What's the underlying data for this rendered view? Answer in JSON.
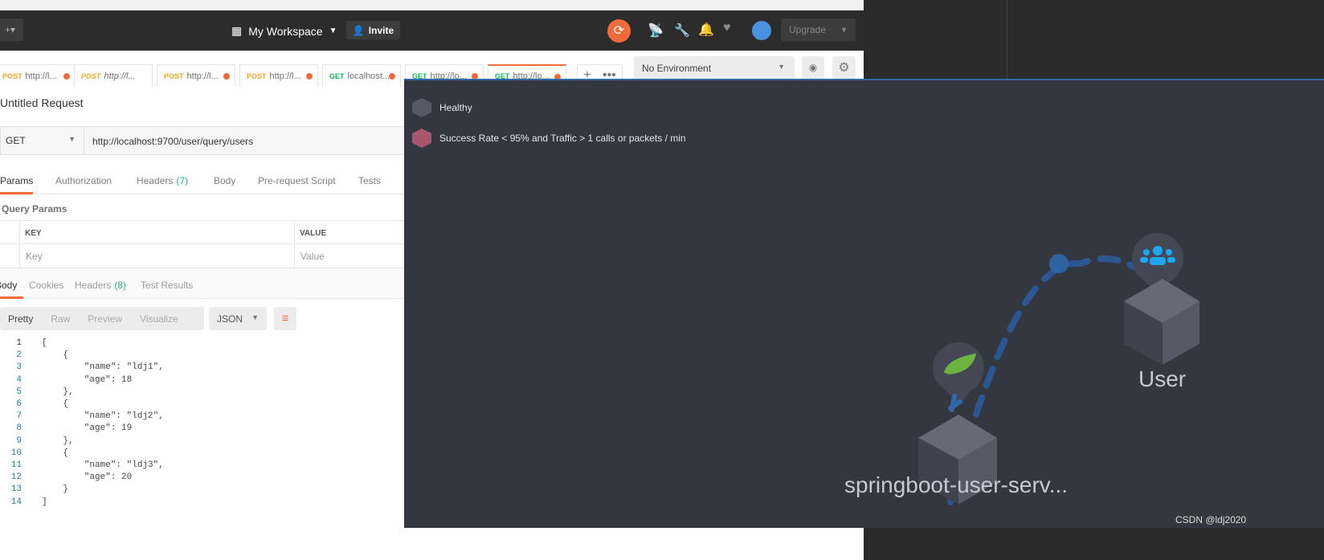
{
  "header": {
    "workspace": "My Workspace",
    "invite": "Invite",
    "upgrade": "Upgrade"
  },
  "tabs": [
    {
      "method": "POST",
      "url": "http://l...",
      "dirty": true,
      "italic": false
    },
    {
      "method": "POST",
      "url": "http://l...",
      "dirty": false,
      "italic": true
    },
    {
      "method": "POST",
      "url": "http://l...",
      "dirty": true,
      "italic": false
    },
    {
      "method": "POST",
      "url": "http://l...",
      "dirty": true,
      "italic": false
    },
    {
      "method": "GET",
      "url": "localhost...",
      "dirty": true,
      "italic": false
    },
    {
      "method": "GET",
      "url": "http://lo...",
      "dirty": true,
      "italic": false
    },
    {
      "method": "GET",
      "url": "http://lo...",
      "dirty": true,
      "italic": false,
      "active": true
    }
  ],
  "environment": "No Environment",
  "request": {
    "title": "Untitled Request",
    "method": "GET",
    "url": "http://localhost:9700/user/query/users"
  },
  "req_tabs": [
    "Params",
    "Authorization",
    "Headers",
    "Body",
    "Pre-request Script",
    "Tests"
  ],
  "req_headers_count": "(7)",
  "query_params": {
    "title": "Query Params",
    "key_col": "KEY",
    "value_col": "VALUE",
    "key_ph": "Key",
    "value_ph": "Value"
  },
  "resp_tabs": [
    "Body",
    "Cookies",
    "Headers",
    "Test Results"
  ],
  "resp_headers_count": "(8)",
  "view_modes": [
    "Pretty",
    "Raw",
    "Preview",
    "Visualize"
  ],
  "format": "JSON",
  "code_lines": [
    "[",
    "    {",
    "        \"name\": \"ldj1\",",
    "        \"age\": 18",
    "    },",
    "    {",
    "        \"name\": \"ldj2\",",
    "        \"age\": 19",
    "    },",
    "    {",
    "        \"name\": \"ldj3\",",
    "        \"age\": 20",
    "    }",
    "]"
  ],
  "legend": [
    {
      "label": "Healthy",
      "color": "#555a66"
    },
    {
      "label": "Success Rate < 95% and Traffic > 1 calls or packets / min",
      "color": "#a8556e"
    }
  ],
  "nodes": {
    "service": "springboot-user-serv...",
    "user": "User"
  },
  "watermark": "CSDN @ldj2020",
  "colors": {
    "accent": "#f26b3a",
    "link": "#2f6aa8",
    "spring": "#6db33f",
    "user_icon": "#1ea7f0"
  }
}
